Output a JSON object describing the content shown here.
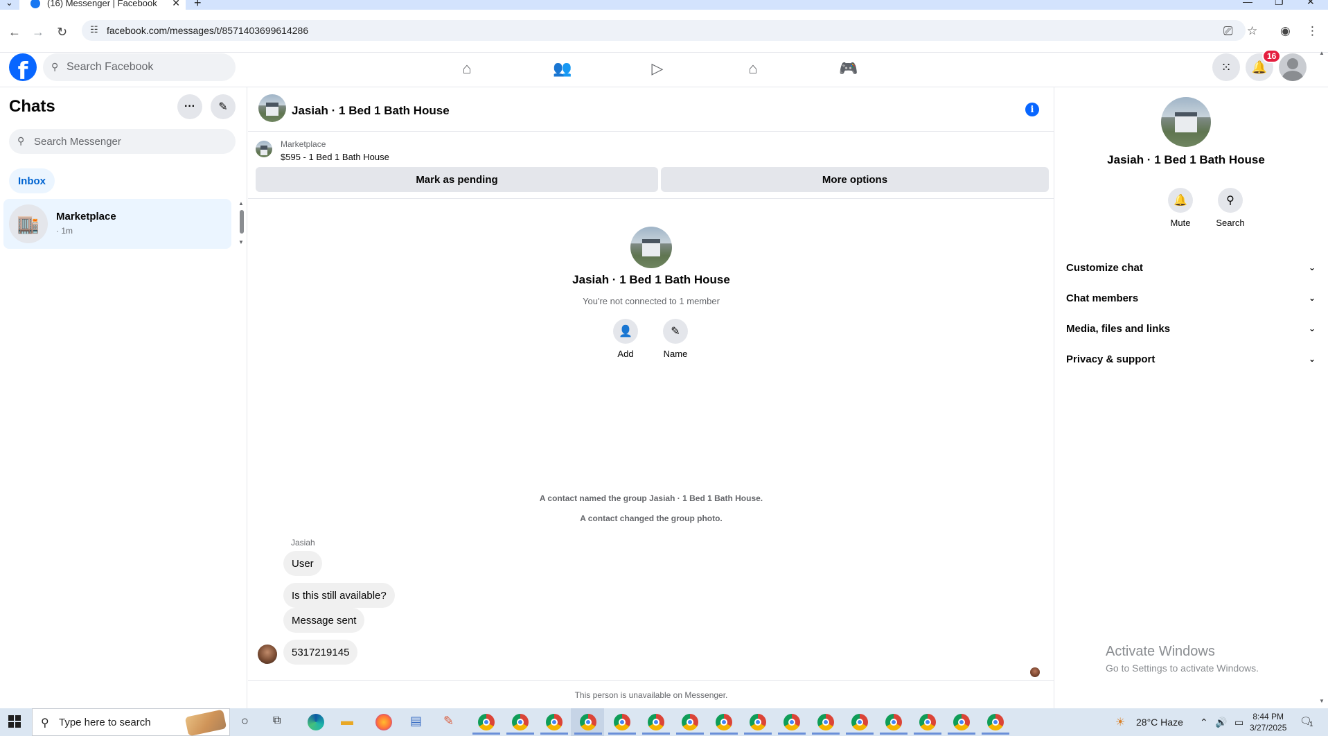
{
  "browser": {
    "tab_title": "(16) Messenger | Facebook",
    "url": "facebook.com/messages/t/8571403699614286"
  },
  "fb": {
    "search_placeholder": "Search Facebook",
    "notification_count": "16"
  },
  "sidebar": {
    "title": "Chats",
    "search_placeholder": "Search Messenger",
    "inbox_label": "Inbox",
    "chats": [
      {
        "name": "Marketplace",
        "time": "· 1m"
      }
    ]
  },
  "conversation": {
    "title": "Jasiah · 1 Bed 1 Bath House",
    "marketplace_label": "Marketplace",
    "listing": "$595 - 1 Bed 1 Bath House",
    "mark_pending_label": "Mark as pending",
    "more_options_label": "More options",
    "intro_name": "Jasiah · 1 Bed 1 Bath House",
    "intro_sub": "You're not connected to 1 member",
    "add_label": "Add",
    "name_label": "Name",
    "system_messages": [
      "A contact named the group Jasiah · 1 Bed 1 Bath House.",
      "A contact changed the group photo."
    ],
    "sender_name": "Jasiah",
    "messages": [
      "User",
      "Is this still available?",
      "Message sent",
      "5317219145"
    ],
    "unavailable_notice": "This person is unavailable on Messenger."
  },
  "info_panel": {
    "name": "Jasiah · 1 Bed 1 Bath House",
    "mute_label": "Mute",
    "search_label": "Search",
    "sections": [
      "Customize chat",
      "Chat members",
      "Media, files and links",
      "Privacy & support"
    ]
  },
  "watermark": {
    "line1": "Activate Windows",
    "line2": "Go to Settings to activate Windows."
  },
  "taskbar": {
    "search_placeholder": "Type here to search",
    "weather": "28°C  Haze",
    "time": "8:44 PM",
    "date": "3/27/2025",
    "notification_count": "1"
  },
  "colors": {
    "fb_blue": "#0866ff",
    "badge_red": "#e41e3f",
    "selected_bg": "#ebf5ff"
  }
}
